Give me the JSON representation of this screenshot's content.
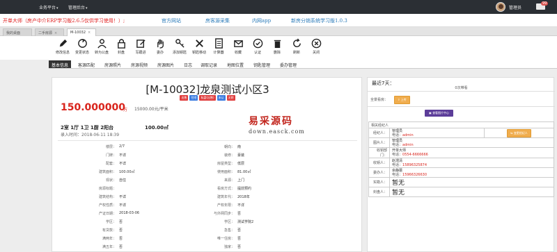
{
  "topbar": {
    "menus": [
      "业务平台",
      "管理后台"
    ],
    "user": "管理员",
    "message_count": "99"
  },
  "notice": {
    "warning": "开单大师（房产中介ERP学习版2.6.5仅供学习使用！）;",
    "links": [
      "官方网站",
      "房客源采集",
      "内网app",
      "新房分销系统学习版1.0.3"
    ]
  },
  "tabs": [
    "我的桌面",
    "二手房源",
    "M-10032"
  ],
  "toolbar": {
    "items": [
      {
        "label": "修改信息",
        "icon": "pencil-icon"
      },
      {
        "label": "变更状态",
        "icon": "refresh-icon"
      },
      {
        "label": "转为公盘",
        "icon": "user-icon"
      },
      {
        "label": "封盘",
        "icon": "lock-icon"
      },
      {
        "label": "写跟进",
        "icon": "edit-icon"
      },
      {
        "label": "委办",
        "icon": "hand-icon"
      },
      {
        "label": "添加钥匙",
        "icon": "key-icon"
      },
      {
        "label": "钥匙移动",
        "icon": "wrench-icon"
      },
      {
        "label": "计算器",
        "icon": "calculator-icon"
      },
      {
        "label": "收藏",
        "icon": "mail-icon"
      },
      {
        "label": "认证",
        "icon": "check-icon"
      },
      {
        "label": "删除",
        "icon": "trash-icon"
      },
      {
        "label": "刷新",
        "icon": "reload-icon"
      },
      {
        "label": "关闭",
        "icon": "close-icon"
      }
    ]
  },
  "subtabs": [
    "基本信息",
    "客源匹配",
    "房源照片",
    "房源视频",
    "房源图片",
    "日志",
    "调取记录",
    "地图位置",
    "钥匙管理",
    "委办管理"
  ],
  "property": {
    "title": "[M-10032]龙泉测试小区3",
    "badges": [
      {
        "text": "出售",
        "color": "#e03d3d"
      },
      {
        "text": "住宅",
        "color": "#3d7de0"
      },
      {
        "text": "私盘(出售)",
        "color": "#e03d3d"
      },
      {
        "text": "未认",
        "color": "#3d7de0"
      },
      {
        "text": "无钥",
        "color": "#e03d3d"
      }
    ],
    "price": "150.000000",
    "price_unit": "万",
    "unit_price": "15000.00元/平米",
    "layout": "2室 1厅 1卫 1厨 2阳台",
    "area": "100.00㎡",
    "entry_time": "录入时间：2018-06-11 18:39"
  },
  "watermark": {
    "line1": "易采源码",
    "line2": "down.easck.com"
  },
  "details_left": [
    {
      "k": "楼层：",
      "v": "2/7"
    },
    {
      "k": "门牌：",
      "v": "不详"
    },
    {
      "k": "配套：",
      "v": "不详"
    },
    {
      "k": "建筑面积：",
      "v": "100.00㎡"
    },
    {
      "k": "现状：",
      "v": "自住"
    },
    {
      "k": "房源标题：",
      "v": ""
    },
    {
      "k": "建筑结构：",
      "v": "不详"
    },
    {
      "k": "产权性质：",
      "v": "不详"
    },
    {
      "k": "产证日期：",
      "v": "2018-03-06"
    },
    {
      "k": "学区：",
      "v": "否"
    },
    {
      "k": "有贷款：",
      "v": "否"
    },
    {
      "k": "满两年：",
      "v": "否"
    },
    {
      "k": "满五年：",
      "v": "否"
    }
  ],
  "details_right": [
    {
      "k": "朝向：",
      "v": "南"
    },
    {
      "k": "装修：",
      "v": "豪装"
    },
    {
      "k": "房屋类型：",
      "v": "低层"
    },
    {
      "k": "使用面积：",
      "v": "81.00㎡"
    },
    {
      "k": "来源：",
      "v": "上门"
    },
    {
      "k": "看房方式：",
      "v": "提前预约"
    },
    {
      "k": "建筑年代：",
      "v": "2018年"
    },
    {
      "k": "产权年限：",
      "v": "不详"
    },
    {
      "k": "与外网同步：",
      "v": "否"
    },
    {
      "k": "学区：",
      "v": "测试学院2"
    },
    {
      "k": "急售：",
      "v": "否"
    },
    {
      "k": "唯一住房：",
      "v": "否"
    },
    {
      "k": "独家：",
      "v": "否"
    }
  ],
  "sidebar": {
    "recent_label": "最近7天：",
    "recent_value": "0次带看",
    "viewer_label": "全景看房：",
    "upload_button": "上传",
    "image_center_button": "查看图片中心",
    "related_header": "相关经纪人",
    "agents": [
      {
        "label": "经纪人：",
        "name": "管理员",
        "phone_label": "电话：",
        "phone": "admin",
        "action": "变更经纪人"
      },
      {
        "label": "图片人：",
        "name": "管理员",
        "phone_label": "电话：",
        "phone": "admin"
      },
      {
        "label": "收钥部门：",
        "name": "开单大师",
        "phone_label": "电话：",
        "phone": "0554-6666666"
      },
      {
        "label": "收钥人：",
        "name": "赵渭清",
        "phone_label": "电话：",
        "phone": "15896325874"
      },
      {
        "label": "委办人：",
        "name": "余静蕾",
        "phone_label": "电话：",
        "phone": "15966326630"
      },
      {
        "label": "实勘人：",
        "none": "暂无"
      },
      {
        "label": "封盘人：",
        "none": "暂无"
      }
    ]
  }
}
